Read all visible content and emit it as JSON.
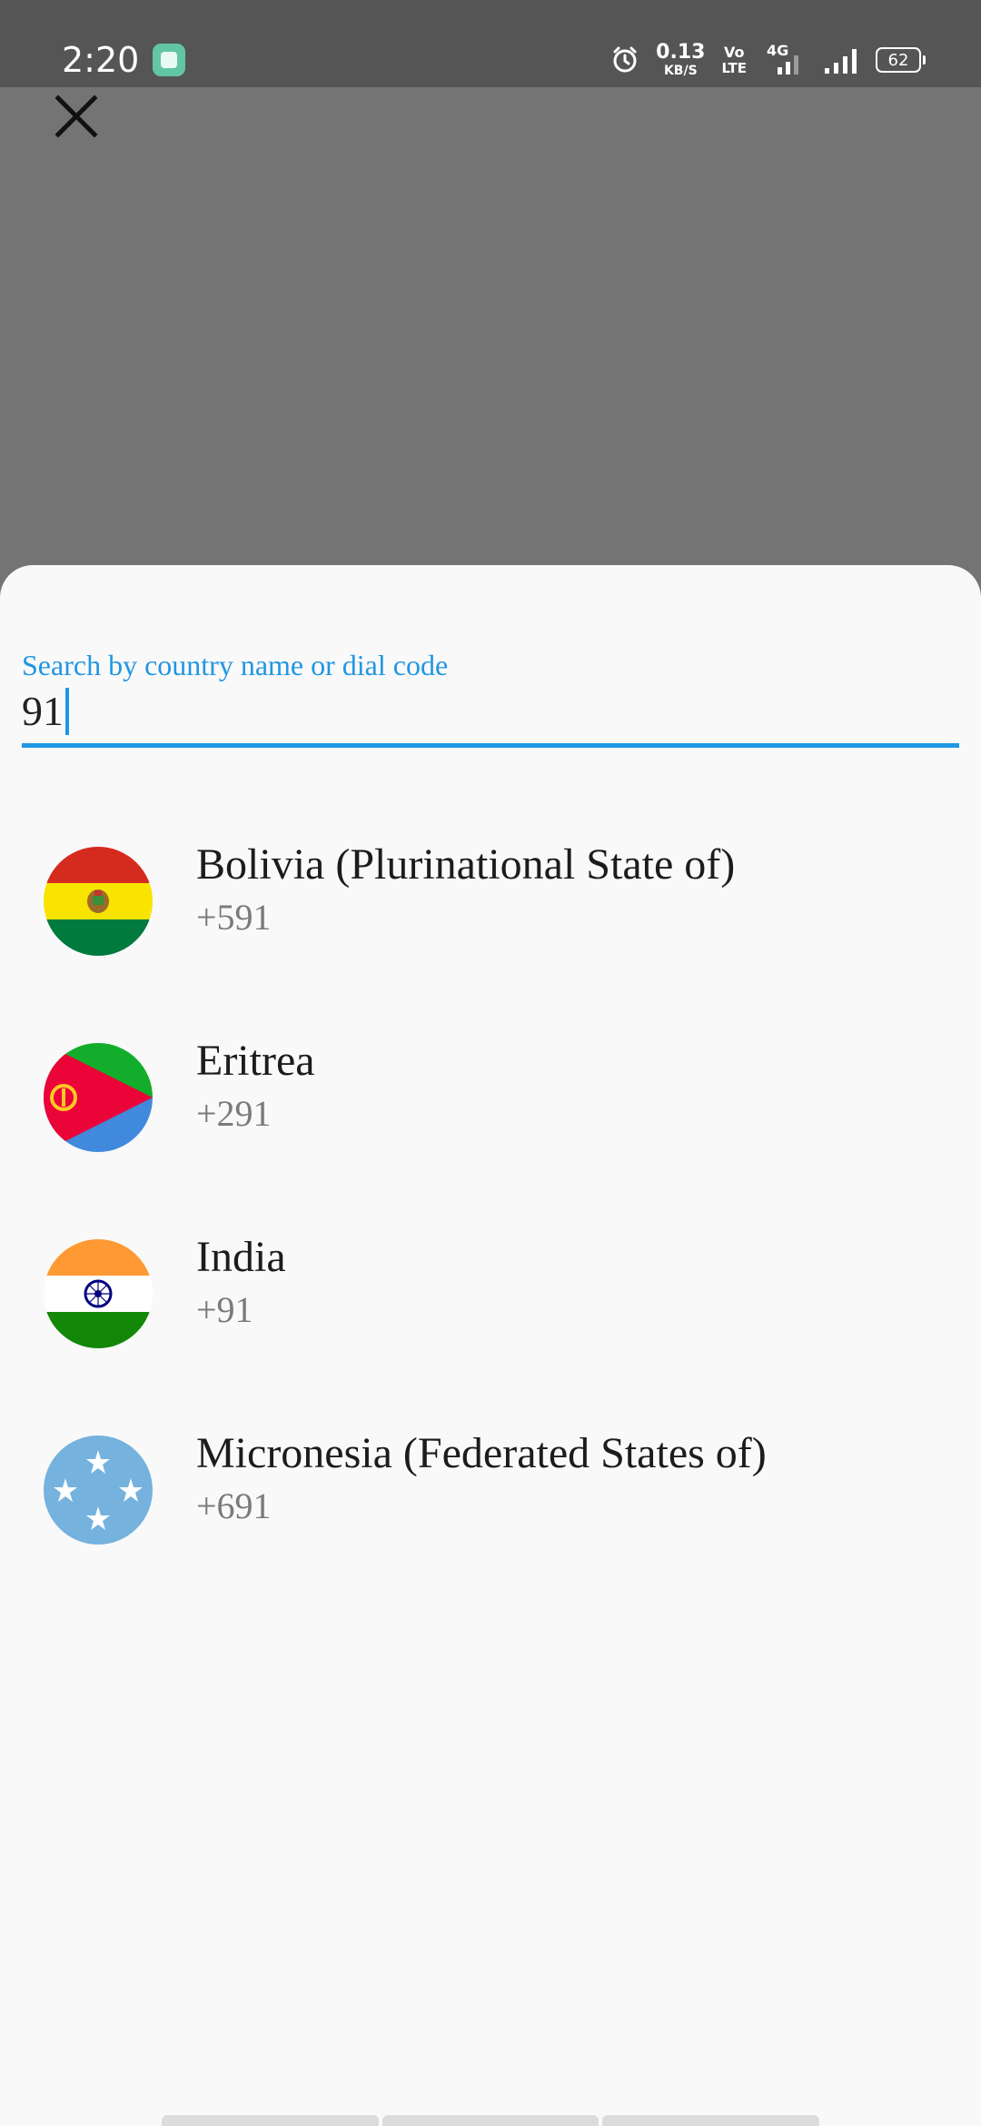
{
  "status_bar": {
    "time": "2:20",
    "net_speed_value": "0.13",
    "net_speed_unit": "KB/S",
    "volte_top": "Vo",
    "volte_bottom": "LTE",
    "network_type": "4G",
    "battery_level": "62"
  },
  "header": {
    "close_icon": "close-icon"
  },
  "search": {
    "label": "Search by country name or dial code",
    "value": "91"
  },
  "countries": [
    {
      "name": "Bolivia (Plurinational State of)",
      "dial_code": "+591",
      "flag": "bolivia-flag-icon"
    },
    {
      "name": "Eritrea",
      "dial_code": "+291",
      "flag": "eritrea-flag-icon"
    },
    {
      "name": "India",
      "dial_code": "+91",
      "flag": "india-flag-icon"
    },
    {
      "name": "Micronesia (Federated States of)",
      "dial_code": "+691",
      "flag": "micronesia-flag-icon"
    }
  ],
  "colors": {
    "accent": "#2196e3",
    "scrim": "#747474",
    "sheet_background": "#f9f9f9"
  }
}
